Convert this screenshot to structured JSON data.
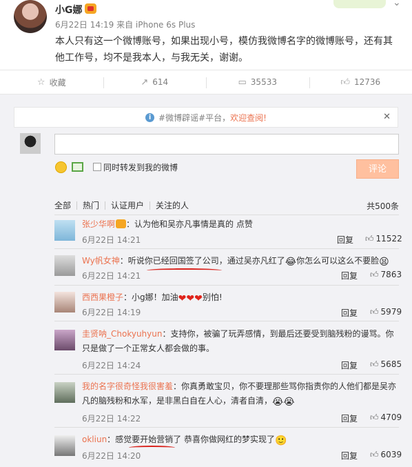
{
  "post": {
    "author": "小G娜",
    "meta": "6月22日 14:19 来自 iPhone 6s Plus",
    "text": "本人只有这一个微博账号，如果出现小号，模仿我微博名字的微博账号，还有其他工作号，均不是我本人，与我无关，谢谢。"
  },
  "actions": {
    "favorite": "收藏",
    "repost": "614",
    "comment": "35533",
    "like": "12736"
  },
  "notice": {
    "prefix": "#微博辟谣#平台，",
    "highlight": "欢迎查阅!"
  },
  "composer": {
    "repost_label": "同时转发到我的微博",
    "submit": "评论"
  },
  "filter": {
    "all": "全部",
    "hot": "热门",
    "verified": "认证用户",
    "following": "关注的人",
    "total": "共500条"
  },
  "comments": [
    {
      "nick": "张少华啊",
      "text": "：认为他和吴亦凡事情是真的 点赞",
      "time": "6月22日 14:21",
      "reply": "回复",
      "likes": "11522"
    },
    {
      "nick": "Wy帆女神",
      "text": "：听说你已经回国签了公司，通过吴亦凡红了",
      "text2": "你怎么可以这么不要脸",
      "time": "6月22日 14:21",
      "reply": "回复",
      "likes": "7863"
    },
    {
      "nick": "西西果橙子",
      "text": "：小g娜！加油",
      "text2": "别怕!",
      "time": "6月22日 14:19",
      "reply": "回复",
      "likes": "5979"
    },
    {
      "nick": "圭贤呐_Chokyuhyun",
      "text": "：支持你，被骗了玩弄感情，到最后还要受到脑残粉的谩骂。你只是做了一个正常女人都会做的事。",
      "time": "6月22日 14:24",
      "reply": "回复",
      "likes": "5685"
    },
    {
      "nick": "我的名字很奇怪我很害羞",
      "text": "：你真勇敢宝贝，你不要理那些骂你指责你的人他们都是吴亦凡的脑残粉和水军，是非黑白自在人心，清者自清，",
      "time": "6月22日 14:22",
      "reply": "回复",
      "likes": "4709"
    },
    {
      "nick": "okliun",
      "text": "：感觉要开始营销了 恭喜你做网红的梦实现了",
      "time": "6月22日 14:20",
      "reply": "回复",
      "likes": "6039"
    }
  ]
}
